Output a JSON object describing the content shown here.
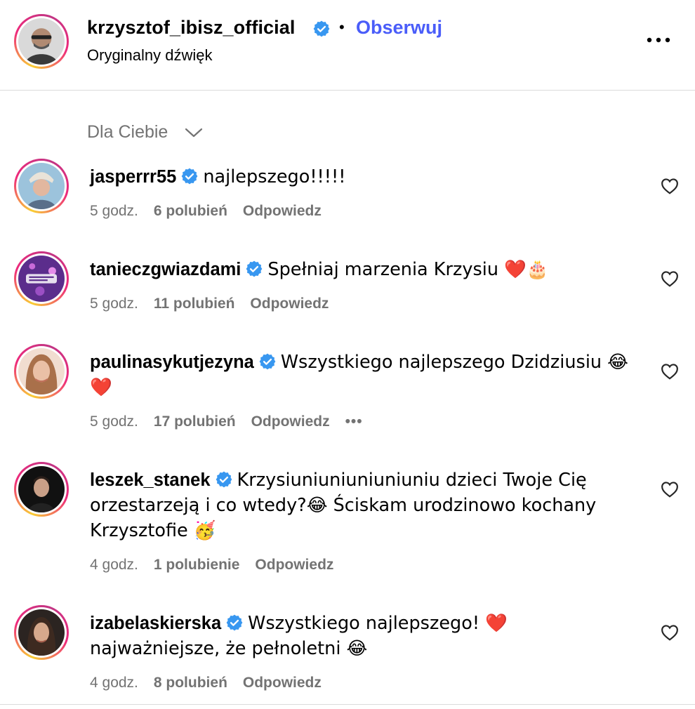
{
  "header": {
    "username": "krzysztof_ibisz_official",
    "separator": "•",
    "follow_label": "Obserwuj",
    "audio_label": "Oryginalny dźwięk",
    "avatar_icon": "avatar-icon",
    "more_icon": "more-options-icon"
  },
  "sort": {
    "label": "Dla Ciebie"
  },
  "comments": [
    {
      "username": "jasperrr55",
      "text": "najlepszego!!!!!",
      "time": "5 godz.",
      "likes": "6 polubień",
      "reply": "Odpowiedz"
    },
    {
      "username": "tanieczgwiazdami",
      "text": "Spełniaj marzenia Krzysiu ❤️🎂",
      "time": "5 godz.",
      "likes": "11 polubień",
      "reply": "Odpowiedz"
    },
    {
      "username": "paulinasykutjezyna",
      "text": "Wszystkiego najlepszego Dzidziusiu 😂❤️",
      "time": "5 godz.",
      "likes": "17 polubień",
      "reply": "Odpowiedz",
      "more": "•••"
    },
    {
      "username": "leszek_stanek",
      "text": "Krzysiuniuniuniuniuniu dzieci Twoje Cię orzestarzeją i co wtedy?😂 Ściskam urodzinowo kochany Krzysztofie 🥳",
      "time": "4 godz.",
      "likes": "1 polubienie",
      "reply": "Odpowiedz"
    },
    {
      "username": "izabelaskierska",
      "text": "Wszystkiego najlepszego! ❤️ najważniejsze, że pełnoletni 😂",
      "time": "4 godz.",
      "likes": "8 polubień",
      "reply": "Odpowiedz"
    }
  ],
  "colors": {
    "link_blue": "#4a5df9",
    "verified_blue": "#3897f0",
    "meta_gray": "#737373",
    "divider": "#dbdbdb"
  }
}
